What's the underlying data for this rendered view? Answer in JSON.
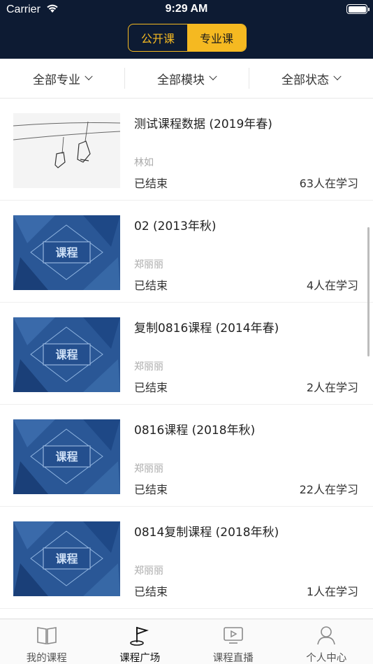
{
  "status_bar": {
    "carrier": "Carrier",
    "time": "9:29 AM"
  },
  "segment": {
    "public_label": "公开课",
    "professional_label": "专业课",
    "selected": "专业课"
  },
  "filters": [
    {
      "label": "全部专业"
    },
    {
      "label": "全部模块"
    },
    {
      "label": "全部状态"
    }
  ],
  "courses": [
    {
      "thumbnail": "chairlift-photo",
      "title": "测试课程数据 (2019年春)",
      "teacher": "林如",
      "status": "已结束",
      "learners": "63人在学习"
    },
    {
      "thumbnail": "course-banner",
      "thumbnail_text": "课程",
      "title": "02 (2013年秋)",
      "teacher": "郑丽丽",
      "status": "已结束",
      "learners": "4人在学习"
    },
    {
      "thumbnail": "course-banner",
      "thumbnail_text": "课程",
      "title": "复制0816课程 (2014年春)",
      "teacher": "郑丽丽",
      "status": "已结束",
      "learners": "2人在学习"
    },
    {
      "thumbnail": "course-banner",
      "thumbnail_text": "课程",
      "title": "0816课程 (2018年秋)",
      "teacher": "郑丽丽",
      "status": "已结束",
      "learners": "22人在学习"
    },
    {
      "thumbnail": "course-banner",
      "thumbnail_text": "课程",
      "title": "0814复制课程 (2018年秋)",
      "teacher": "郑丽丽",
      "status": "已结束",
      "learners": "1人在学习"
    }
  ],
  "tabs": [
    {
      "label": "我的课程",
      "icon": "book-icon"
    },
    {
      "label": "课程广场",
      "icon": "flag-icon",
      "active": true
    },
    {
      "label": "课程直播",
      "icon": "play-screen-icon"
    },
    {
      "label": "个人中心",
      "icon": "person-icon"
    }
  ],
  "colors": {
    "header_bg": "#0d1b33",
    "accent": "#f5b921"
  }
}
